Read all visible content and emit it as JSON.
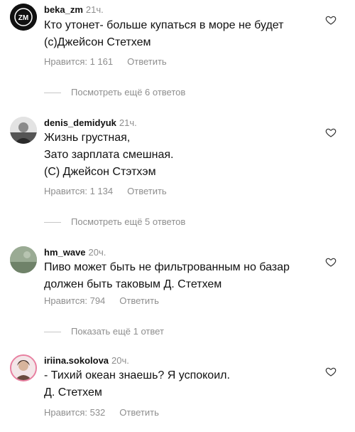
{
  "comments": [
    {
      "user": "beka_zm",
      "time": "21ч.",
      "text": "Кто утонет- больше купаться в море не будет\n(с)Джейсон Стетхем",
      "likes": "Нравится: 1 161",
      "reply": "Ответить",
      "avatar_text": "ZM"
    },
    {
      "user": "denis_demidyuk",
      "time": "21ч.",
      "text": "Жизнь грустная,\nЗато зарплата смешная.\n(С) Джейсон Стэтхэм",
      "likes": "Нравится: 1 134",
      "reply": "Ответить"
    },
    {
      "user": "hm_wave",
      "time": "20ч.",
      "text": "Пиво может быть не фильтрованным но базар\nдолжен быть таковым  Д. Стетхем",
      "likes": "Нравится: 794",
      "reply": "Ответить"
    },
    {
      "user": "iriina.sokolova",
      "time": "20ч.",
      "text": "- Тихий океан знаешь? Я успокоил.\nД. Стетхем",
      "likes": "Нравится: 532",
      "reply": "Ответить"
    }
  ],
  "more_replies": [
    "Посмотреть ещё 6 ответов",
    "Посмотреть ещё 5 ответов",
    "Показать ещё 1 ответ"
  ],
  "icons": {
    "like": "heart-outline-icon"
  },
  "colors": {
    "username": "#111111",
    "secondary": "#8e8e8e"
  }
}
